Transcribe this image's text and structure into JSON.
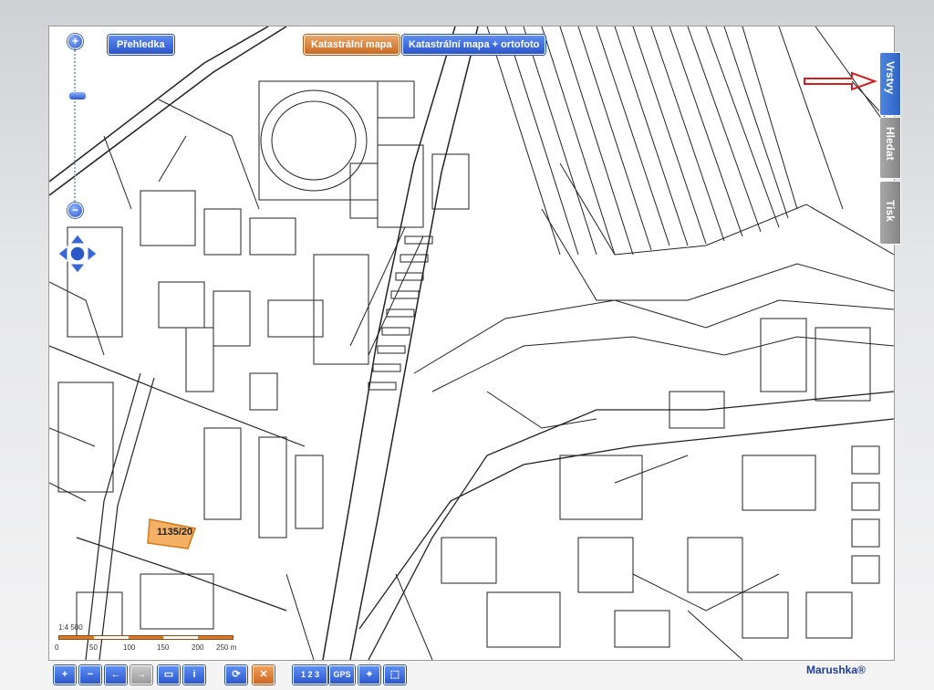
{
  "top_buttons": {
    "overview": "Přehledka",
    "cadastral_map": "Katastrální mapa",
    "cadastral_ortho": "Katastrální mapa + ortofoto"
  },
  "side_tabs": [
    {
      "label": "Vrstvy",
      "active": true
    },
    {
      "label": "Hledat",
      "active": false
    },
    {
      "label": "Tisk",
      "active": false
    }
  ],
  "map": {
    "parcel_label": "1135/20",
    "parcel_color": "#f2a24a",
    "annotation_arrow_color": "#d21f1f"
  },
  "scale_bar": {
    "ratio": "1:4 500",
    "ticks": [
      "0",
      "50",
      "100",
      "150",
      "200",
      "250 m"
    ]
  },
  "toolbar": {
    "zoom_in": "+",
    "zoom_out": "−",
    "back": "←",
    "forward": "→",
    "zoom_box": "▭",
    "info": "i",
    "refresh": "⟳",
    "clear": "✕",
    "measure": "1 2 3",
    "gps": "GPS",
    "locate": "⌖",
    "select": "⬚"
  },
  "brand": "Marushka®",
  "zoom_controls": {
    "plus": "+",
    "minus": "−"
  }
}
